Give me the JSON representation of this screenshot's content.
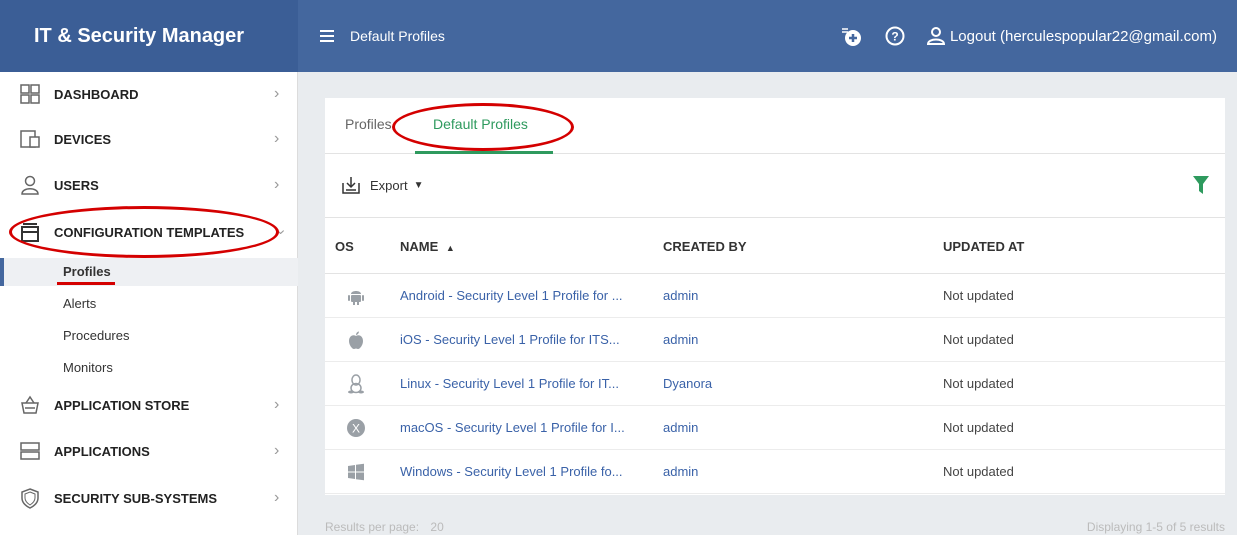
{
  "header": {
    "brand": "IT & Security Manager",
    "page_title": "Default Profiles",
    "logout_label": "Logout (herculespopular22@gmail.com)"
  },
  "sidebar": {
    "items": [
      {
        "label": "DASHBOARD",
        "icon": "dashboard-icon"
      },
      {
        "label": "DEVICES",
        "icon": "devices-icon"
      },
      {
        "label": "USERS",
        "icon": "user-icon"
      },
      {
        "label": "CONFIGURATION TEMPLATES",
        "icon": "templates-icon"
      },
      {
        "label": "APPLICATION STORE",
        "icon": "store-basket-icon"
      },
      {
        "label": "APPLICATIONS",
        "icon": "applications-icon"
      },
      {
        "label": "SECURITY SUB-SYSTEMS",
        "icon": "shield-icon"
      }
    ],
    "sub_items": [
      "Profiles",
      "Alerts",
      "Procedures",
      "Monitors"
    ]
  },
  "tabs": [
    "Profiles",
    "Default Profiles"
  ],
  "toolbar": {
    "export_label": "Export"
  },
  "table": {
    "columns": [
      "OS",
      "NAME",
      "CREATED BY",
      "UPDATED AT"
    ],
    "rows": [
      {
        "os": "android-icon",
        "name": "Android - Security Level 1 Profile for ...",
        "created_by": "admin",
        "updated_at": "Not updated"
      },
      {
        "os": "apple-icon",
        "name": "iOS - Security Level 1 Profile for ITS...",
        "created_by": "admin",
        "updated_at": "Not updated"
      },
      {
        "os": "linux-icon",
        "name": "Linux - Security Level 1 Profile for IT...",
        "created_by": "Dyanora",
        "updated_at": "Not updated"
      },
      {
        "os": "macos-icon",
        "name": "macOS - Security Level 1 Profile for I...",
        "created_by": "admin",
        "updated_at": "Not updated"
      },
      {
        "os": "windows-icon",
        "name": "Windows - Security Level 1 Profile fo...",
        "created_by": "admin",
        "updated_at": "Not updated"
      }
    ]
  },
  "footer": {
    "results_label": "Results per page:",
    "per_page": "20",
    "displaying": "Displaying 1-5 of 5 results"
  },
  "colors": {
    "brand_bg": "#3b5e96",
    "topbar_bg": "#44679e",
    "accent_green": "#2e9a5e",
    "link_blue": "#3a62a8",
    "annotation_red": "#d40000"
  }
}
